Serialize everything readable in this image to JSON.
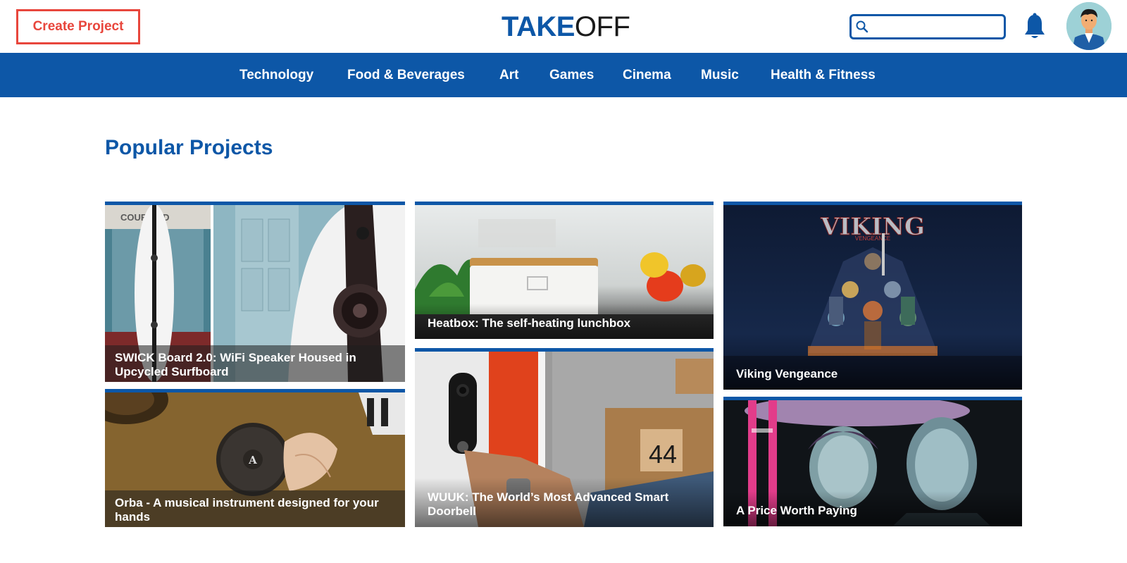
{
  "header": {
    "create_label": "Create Project",
    "logo_bold": "TAKE",
    "logo_light": "OFF",
    "search_placeholder": "",
    "search_value": ""
  },
  "nav": {
    "items": [
      {
        "label": "Technology"
      },
      {
        "label": "Food & Beverages"
      },
      {
        "label": "Art"
      },
      {
        "label": "Games"
      },
      {
        "label": "Cinema"
      },
      {
        "label": "Music"
      },
      {
        "label": "Health & Fitness"
      }
    ]
  },
  "main": {
    "title": "Popular Projects",
    "cards": [
      {
        "title": "SWICK Board 2.0: WiFi Speaker Housed in Upcycled Surfboard"
      },
      {
        "title": "Heatbox: The self-heating lunchbox"
      },
      {
        "title": "Viking Vengeance"
      },
      {
        "title": "Orba - A musical instrument designed for your hands"
      },
      {
        "title": "WUUK: The World’s Most Advanced Smart Doorbell"
      },
      {
        "title": "A Price Worth Paying"
      }
    ],
    "image_text": {
      "surf_sign": "COUR   ARD",
      "viking_logo": "VIKING",
      "viking_sub": "VENGEANCE",
      "box_number": "44",
      "orba_letter": "A"
    }
  },
  "colors": {
    "brand_blue": "#0d57a7",
    "accent_red": "#e8463c"
  }
}
